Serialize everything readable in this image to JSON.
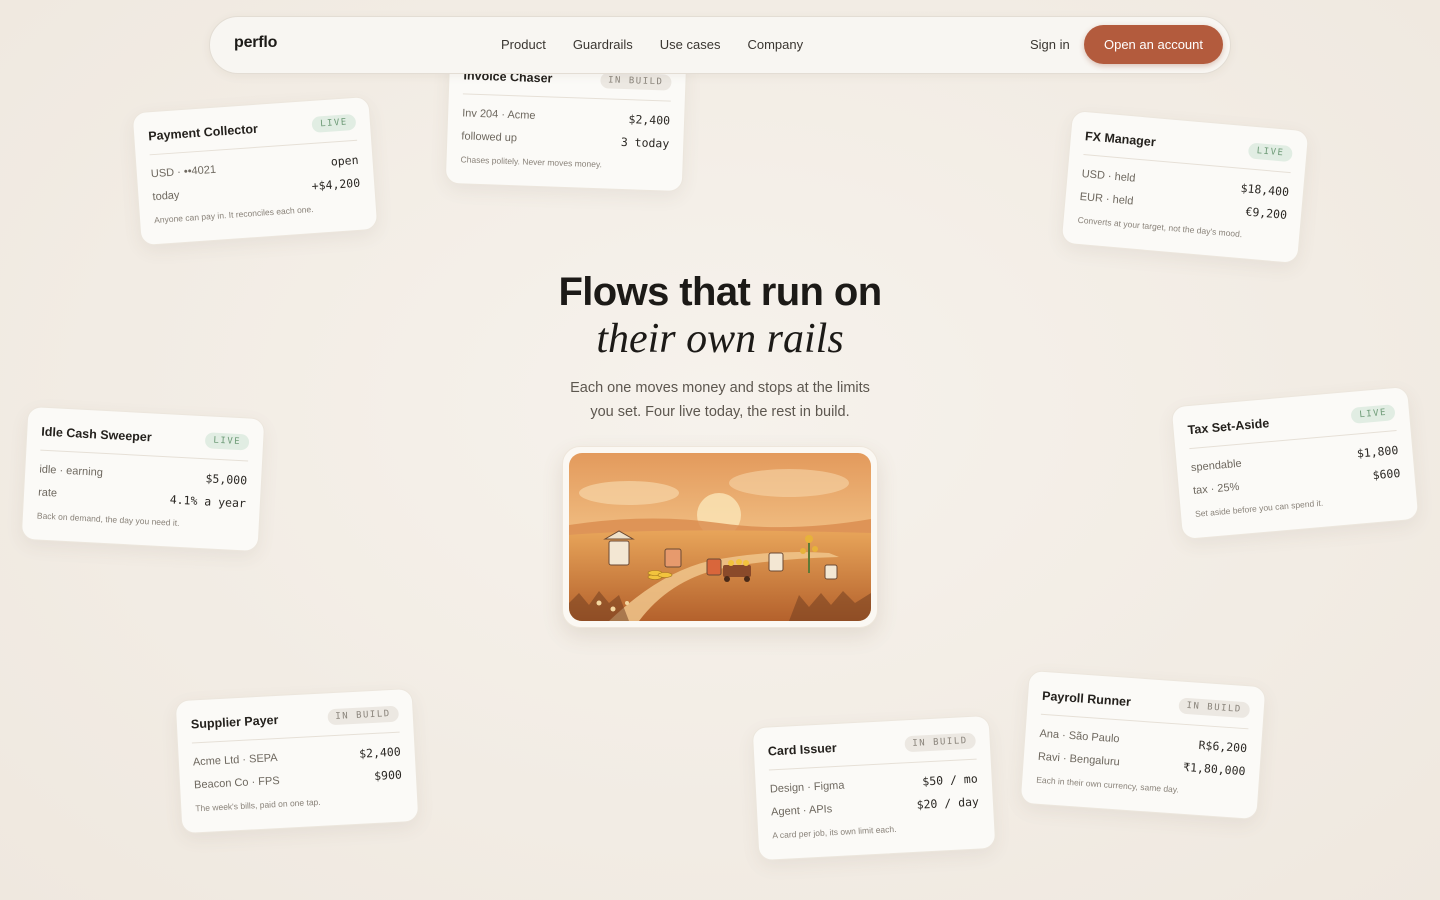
{
  "nav": {
    "logo": "perflo",
    "links": [
      "Product",
      "Guardrails",
      "Use cases",
      "Company"
    ],
    "signin": "Sign in",
    "cta": "Open an account"
  },
  "hero": {
    "title_line1": "Flows that run on",
    "title_line2": "their own rails",
    "subtitle_line1": "Each one moves money and stops at the limits",
    "subtitle_line2": "you set. Four live today, the rest in build."
  },
  "cards": {
    "payment_collector": {
      "title": "Payment Collector",
      "badge": "LIVE",
      "labels": [
        "USD · ••4021",
        "today"
      ],
      "values": [
        "open",
        "+$4,200"
      ],
      "note": "Anyone can pay in. It reconciles each one."
    },
    "invoice_chaser": {
      "title": "Invoice Chaser",
      "badge": "IN BUILD",
      "labels": [
        "Inv 204 · Acme",
        "followed up"
      ],
      "values": [
        "$2,400",
        "3 today"
      ],
      "note": "Chases politely. Never moves money."
    },
    "fx_manager": {
      "title": "FX Manager",
      "badge": "LIVE",
      "labels": [
        "USD · held",
        "EUR · held"
      ],
      "values": [
        "$18,400",
        "€9,200"
      ],
      "note": "Converts at your target, not the day's mood."
    },
    "idle_cash": {
      "title": "Idle Cash Sweeper",
      "badge": "LIVE",
      "labels": [
        "idle · earning",
        "rate"
      ],
      "values": [
        "$5,000",
        "4.1% a year"
      ],
      "note": "Back on demand, the day you need it."
    },
    "tax_setaside": {
      "title": "Tax Set-Aside",
      "badge": "LIVE",
      "labels": [
        "spendable",
        "tax · 25%"
      ],
      "values": [
        "$1,800",
        "$600"
      ],
      "note": "Set aside before you can spend it."
    },
    "supplier_payer": {
      "title": "Supplier Payer",
      "badge": "IN BUILD",
      "labels": [
        "Acme Ltd · SEPA",
        "Beacon Co · FPS"
      ],
      "values": [
        "$2,400",
        "$900"
      ],
      "note": "The week's bills, paid on one tap."
    },
    "card_issuer": {
      "title": "Card Issuer",
      "badge": "IN BUILD",
      "labels": [
        "Design · Figma",
        "Agent · APIs"
      ],
      "values": [
        "$50 / mo",
        "$20 / day"
      ],
      "note": "A card per job, its own limit each."
    },
    "payroll_runner": {
      "title": "Payroll Runner",
      "badge": "IN BUILD",
      "labels": [
        "Ana · São Paulo",
        "Ravi · Bengaluru"
      ],
      "values": [
        "R$6,200",
        "₹1,80,000"
      ],
      "note": "Each in their own currency, same day."
    }
  },
  "colors": {
    "accent": "#b35b3d",
    "live_badge_bg": "#e1ede3",
    "live_badge_text": "#6d9a76",
    "build_badge_bg": "#ece8e2"
  },
  "illustration": {
    "icon": "autumn-field-illustration"
  }
}
